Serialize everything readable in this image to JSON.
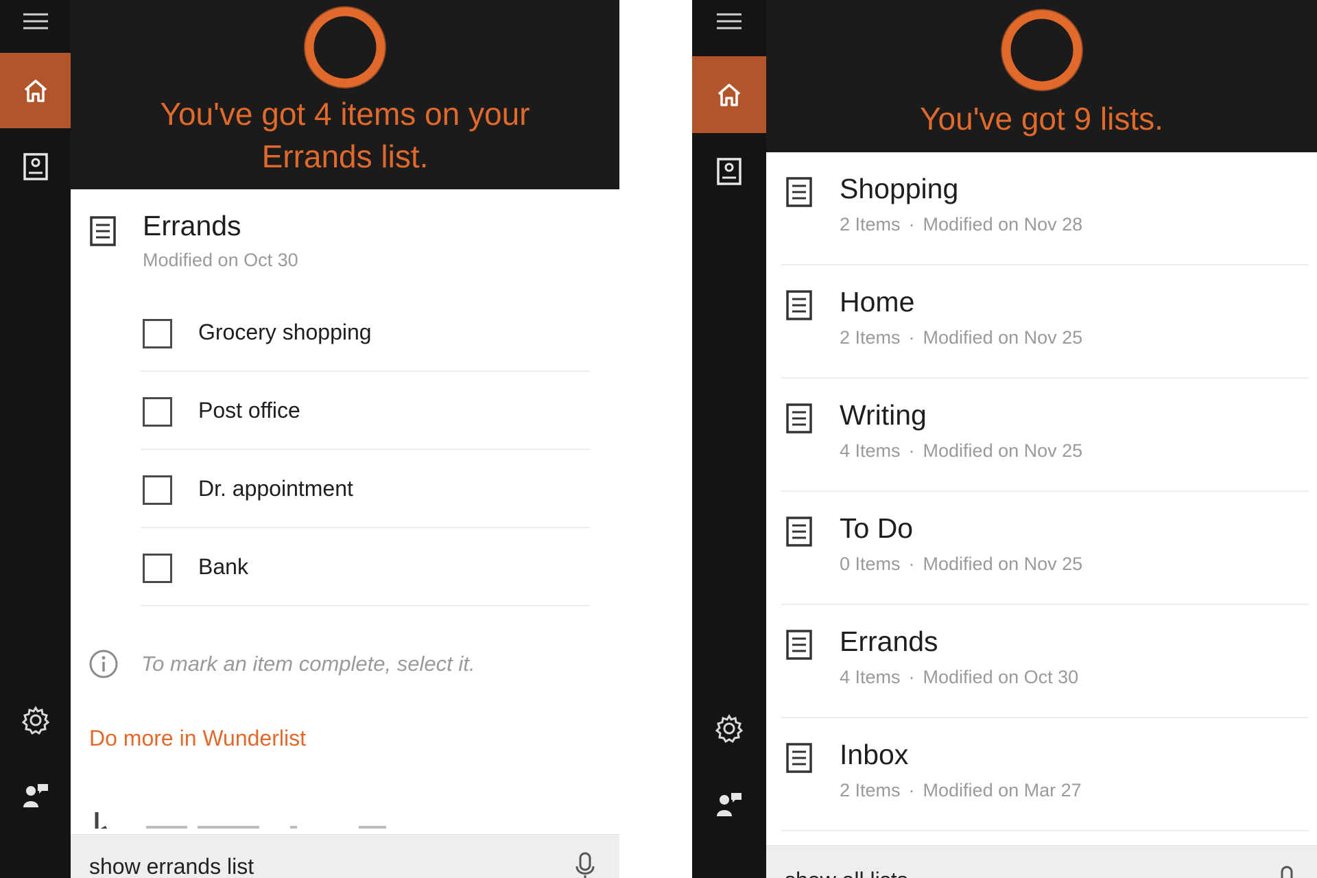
{
  "left": {
    "rail": {
      "menu_icon": "hamburger-icon",
      "home_icon": "home-icon",
      "notebook_icon": "notebook-icon",
      "settings_icon": "gear-icon",
      "feedback_icon": "feedback-icon",
      "accent": "#b3552a"
    },
    "header": {
      "greeting_line1": "You've got 4 items on your",
      "greeting_line2": "Errands list."
    },
    "list": {
      "title": "Errands",
      "subtitle": "Modified on Oct 30"
    },
    "tasks": [
      {
        "label": "Grocery shopping",
        "done": false
      },
      {
        "label": "Post office",
        "done": false
      },
      {
        "label": "Dr. appointment",
        "done": false
      },
      {
        "label": "Bank",
        "done": false
      }
    ],
    "hint": "To mark an item complete, select it.",
    "link": "Do more in Wunderlist",
    "query": "show errands list"
  },
  "right": {
    "header": {
      "greeting": "You've got 9 lists."
    },
    "lists": [
      {
        "name": "Shopping",
        "items": "2 Items",
        "modified": "Modified on Nov 28"
      },
      {
        "name": "Home",
        "items": "2 Items",
        "modified": "Modified on Nov 25"
      },
      {
        "name": "Writing",
        "items": "4 Items",
        "modified": "Modified on Nov 25"
      },
      {
        "name": "To Do",
        "items": "0 Items",
        "modified": "Modified on Nov 25"
      },
      {
        "name": "Errands",
        "items": "4 Items",
        "modified": "Modified on Oct 30"
      },
      {
        "name": "Inbox",
        "items": "2 Items",
        "modified": "Modified on Mar 27"
      }
    ],
    "separator": "·",
    "query": "show all lists"
  },
  "colors": {
    "accent_orange": "#e0692b",
    "header_bg": "#1b1b1b",
    "rail_bg": "#141414"
  }
}
